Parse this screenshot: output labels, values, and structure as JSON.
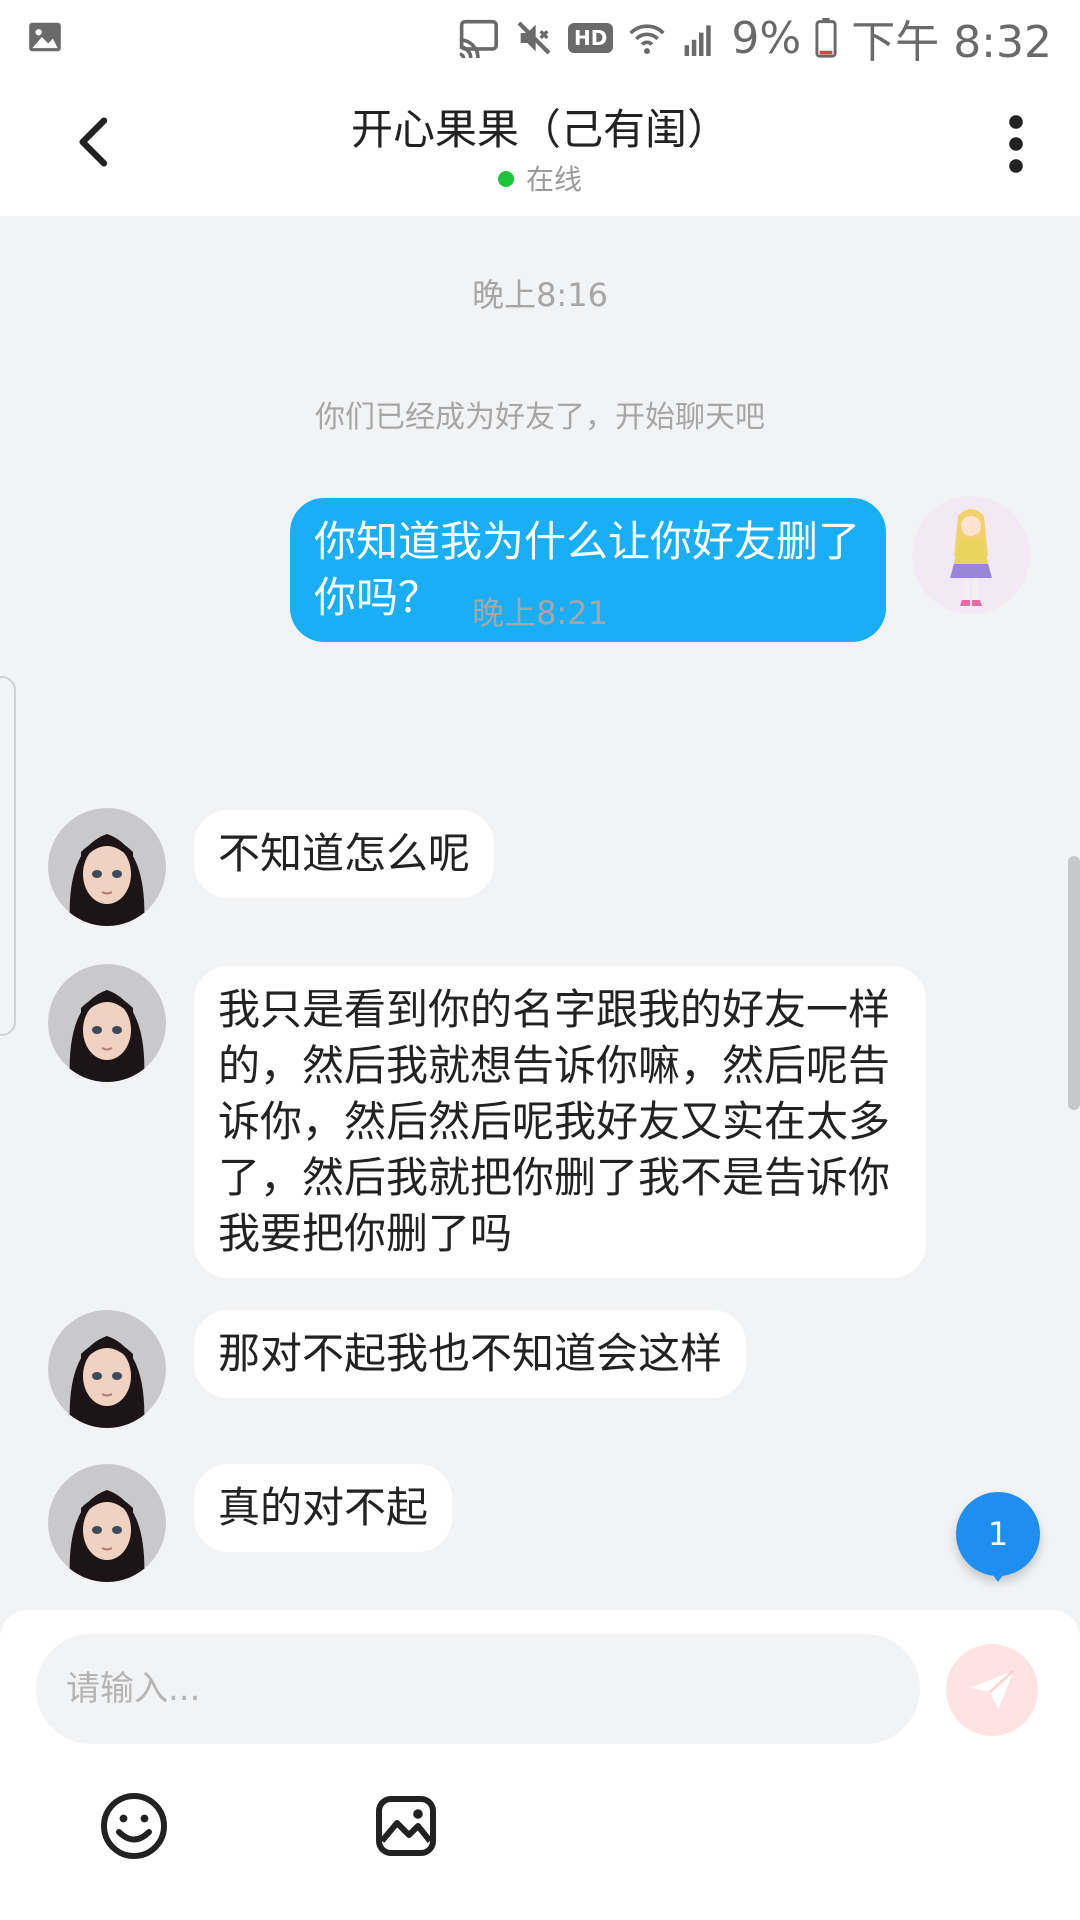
{
  "status_bar": {
    "battery": "9%",
    "time": "下午 8:32",
    "hd_label": "HD",
    "icons": [
      "image-icon",
      "cast-icon",
      "mute-icon",
      "hd-icon",
      "wifi-icon",
      "signal-4g-icon",
      "battery-icon"
    ]
  },
  "header": {
    "title": "开心果果（己有闺）",
    "status": "在线",
    "status_color": "#1fc33e"
  },
  "chat": {
    "time_1": "晚上8:16",
    "system_message": "你们已经成为好友了，开始聊天吧",
    "time_2": "晚上8:21",
    "messages": [
      {
        "side": "right",
        "text": "你知道我为什么让你好友删了你吗？"
      },
      {
        "side": "left",
        "text": "不知道怎么呢"
      },
      {
        "side": "left",
        "text": "我只是看到你的名字跟我的好友一样的，然后我就想告诉你嘛，然后呢告诉你，然后然后呢我好友又实在太多了，然后我就把你删了我不是告诉你我要把你删了吗"
      },
      {
        "side": "left",
        "text": "那对不起我也不知道会这样"
      },
      {
        "side": "left",
        "text": "真的对不起"
      }
    ],
    "unread_count": "1"
  },
  "input_bar": {
    "placeholder": "请输入..."
  },
  "colors": {
    "accent": "#1aaef6",
    "badge": "#1e8ef0",
    "background": "#f2f3f5"
  }
}
